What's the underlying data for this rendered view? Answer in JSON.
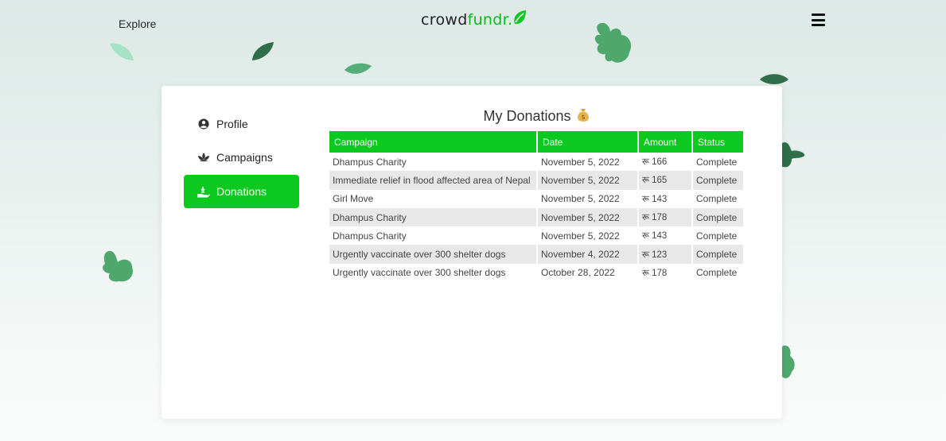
{
  "nav": {
    "explore_label": "Explore",
    "logo_part1": "crowd",
    "logo_part2": "fundr."
  },
  "sidebar": {
    "items": [
      {
        "label": "Profile",
        "icon": "user-circle-icon",
        "active": false
      },
      {
        "label": "Campaigns",
        "icon": "lotus-icon",
        "active": false
      },
      {
        "label": "Donations",
        "icon": "donate-hand-icon",
        "active": true
      }
    ]
  },
  "main": {
    "title": "My Donations",
    "title_emoji": "money-bag-icon",
    "columns": [
      "Campaign",
      "Date",
      "Amount",
      "Status"
    ],
    "rows": [
      {
        "campaign": "Dhampus Charity",
        "date": "November 5, 2022",
        "amount": "रू 166",
        "status": "Complete"
      },
      {
        "campaign": "Immediate relief in flood affected area of Nepal",
        "date": "November 5, 2022",
        "amount": "रू 165",
        "status": "Complete"
      },
      {
        "campaign": "Girl Move",
        "date": "November 5, 2022",
        "amount": "रू 143",
        "status": "Complete"
      },
      {
        "campaign": "Dhampus Charity",
        "date": "November 5, 2022",
        "amount": "रू 178",
        "status": "Complete"
      },
      {
        "campaign": "Dhampus Charity",
        "date": "November 5, 2022",
        "amount": "रू 143",
        "status": "Complete"
      },
      {
        "campaign": "Urgently vaccinate over 300 shelter dogs",
        "date": "November 4, 2022",
        "amount": "रू 123",
        "status": "Complete"
      },
      {
        "campaign": "Urgently vaccinate over 300 shelter dogs",
        "date": "October 28, 2022",
        "amount": "रू 178",
        "status": "Complete"
      }
    ]
  },
  "colors": {
    "accent": "#0cc91f",
    "leaf_dark": "#2f6b47",
    "leaf_mid": "#4ea86c",
    "leaf_light": "#9fdcc0"
  }
}
